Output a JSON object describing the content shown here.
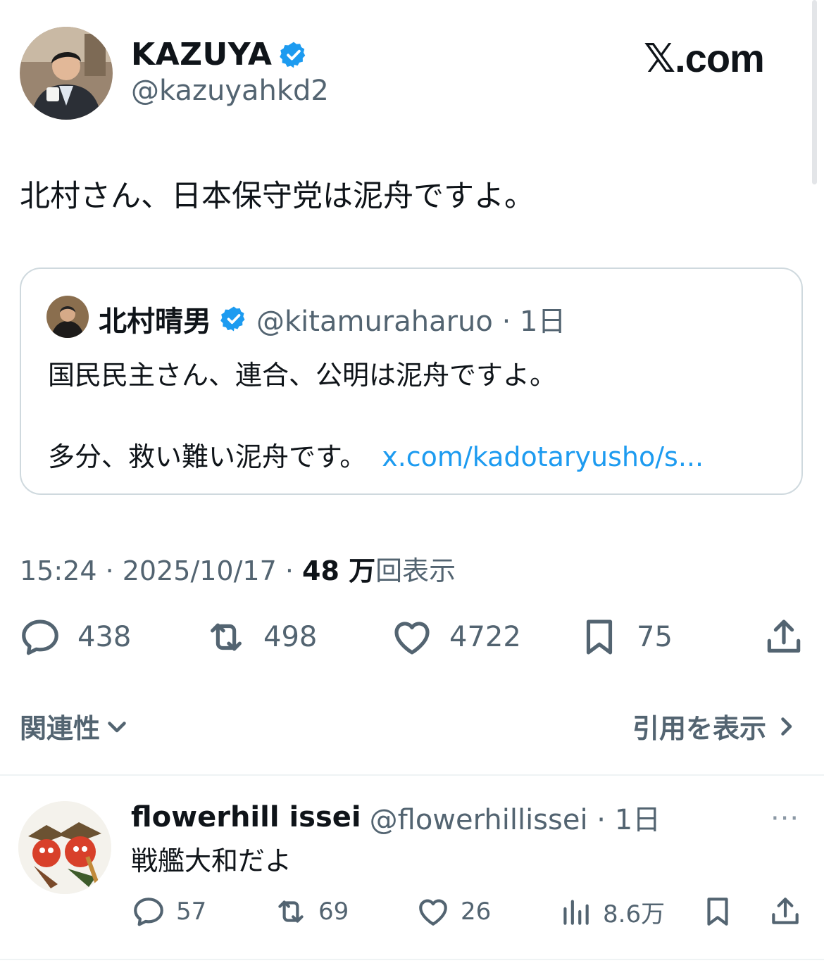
{
  "tweet": {
    "author_name": "KAZUYA",
    "author_handle": "@kazuyahkd2",
    "verified": true,
    "text": "北村さん、日本保守党は泥舟ですよ。",
    "timestamp": "15:24 · 2025/10/17 · ",
    "views_count": "48 万",
    "views_label": "回表示"
  },
  "brand": {
    "logo_text": "𝕏.com"
  },
  "quote": {
    "author_name": "北村晴男",
    "verified": true,
    "handle_time": "@kitamuraharuo · 1日",
    "line1": "国民民主さん、連合、公明は泥舟ですよ。",
    "line2": "多分、救い難い泥舟です。",
    "link": "x.com/kadotaryusho/s..."
  },
  "actions": {
    "replies": "438",
    "reposts": "498",
    "likes": "4722",
    "bookmarks": "75"
  },
  "sort": {
    "label": "関連性"
  },
  "quotes_link": {
    "label": "引用を表示"
  },
  "reply": {
    "author_name": "flowerhill issei",
    "handle_time": "@flowerhillissei · 1日",
    "more": "···",
    "text": "戦艦大和だよ",
    "replies": "57",
    "reposts": "69",
    "likes": "26",
    "views": "8.6万"
  },
  "colors": {
    "text": "#0f1419",
    "secondary": "#536471",
    "link": "#1d9bf0",
    "verified": "#1d9bf0",
    "border": "#cfd9de"
  }
}
